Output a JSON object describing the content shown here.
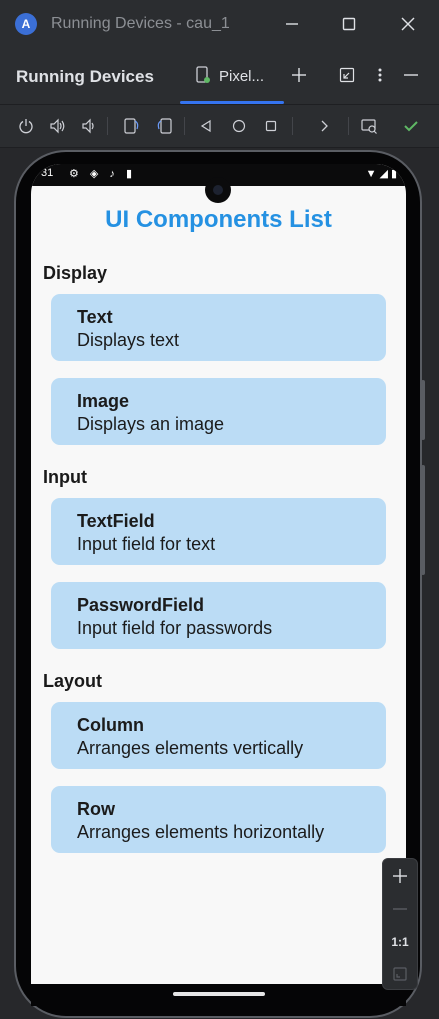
{
  "window": {
    "title": "Running Devices - cau_1",
    "logo_letter": "A"
  },
  "tool_window": {
    "title": "Running Devices",
    "tab_label": "Pixel..."
  },
  "icons": {
    "minimize": "minimize-icon",
    "maximize": "maximize-icon",
    "close": "close-icon",
    "add": "add-icon",
    "more": "more-vertical-icon",
    "hide": "hide-panel-icon"
  },
  "colors": {
    "accent": "#3574f0",
    "app_title": "#2591e2",
    "card_bg": "#bbdcf5",
    "check": "#5fb865"
  },
  "device": {
    "status_time": "31",
    "app_title": "UI Components List",
    "sections": [
      {
        "title": "Display",
        "items": [
          {
            "name": "Text",
            "desc": "Displays text"
          },
          {
            "name": "Image",
            "desc": "Displays an image"
          }
        ]
      },
      {
        "title": "Input",
        "items": [
          {
            "name": "TextField",
            "desc": "Input field for text"
          },
          {
            "name": "PasswordField",
            "desc": "Input field for passwords"
          }
        ]
      },
      {
        "title": "Layout",
        "items": [
          {
            "name": "Column",
            "desc": "Arranges elements vertically"
          },
          {
            "name": "Row",
            "desc": "Arranges elements horizontally"
          }
        ]
      }
    ]
  },
  "zoom": {
    "actual_size_label": "1:1"
  }
}
